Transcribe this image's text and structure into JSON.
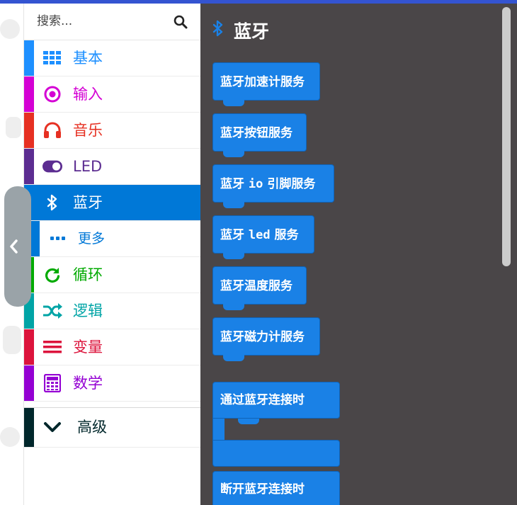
{
  "search": {
    "placeholder": "搜索..."
  },
  "colors": {
    "accent": "#0078D7",
    "flyout_bg": "#4a4648",
    "block_blue": "#1A81E6",
    "basic": "#1E90FF",
    "input": "#D400D4",
    "music": "#E63022",
    "led": "#5C2D91",
    "bluetooth": "#0078D7",
    "loops": "#00AA00",
    "logic": "#00A4A6",
    "variables": "#DC143C",
    "math": "#9400D3",
    "advanced": "#00272B"
  },
  "toolbox": {
    "categories": [
      {
        "label": "基本",
        "icon": "grid-icon"
      },
      {
        "label": "输入",
        "icon": "target-circle-icon"
      },
      {
        "label": "音乐",
        "icon": "headphones-icon"
      },
      {
        "label": "LED",
        "icon": "toggle-icon"
      },
      {
        "label": "蓝牙",
        "icon": "bluetooth-icon",
        "selected": true
      },
      {
        "label": "更多",
        "icon": "more-dots-icon"
      },
      {
        "label": "循环",
        "icon": "refresh-icon"
      },
      {
        "label": "逻辑",
        "icon": "shuffle-icon"
      },
      {
        "label": "变量",
        "icon": "list-bars-icon"
      },
      {
        "label": "数学",
        "icon": "calculator-icon"
      }
    ],
    "advanced": {
      "label": "高级",
      "icon": "chevron-down-icon"
    }
  },
  "flyout": {
    "title": "蓝牙",
    "title_icon": "bluetooth-icon",
    "blocks": [
      "蓝牙加速计服务",
      "蓝牙按钮服务",
      {
        "pre": "蓝牙 ",
        "code": "io",
        "post": " 引脚服务"
      },
      {
        "pre": "蓝牙 ",
        "code": "led",
        "post": " 服务"
      },
      "蓝牙温度服务",
      "蓝牙磁力计服务"
    ],
    "events": [
      "通过蓝牙连接时",
      "断开蓝牙连接时"
    ]
  }
}
